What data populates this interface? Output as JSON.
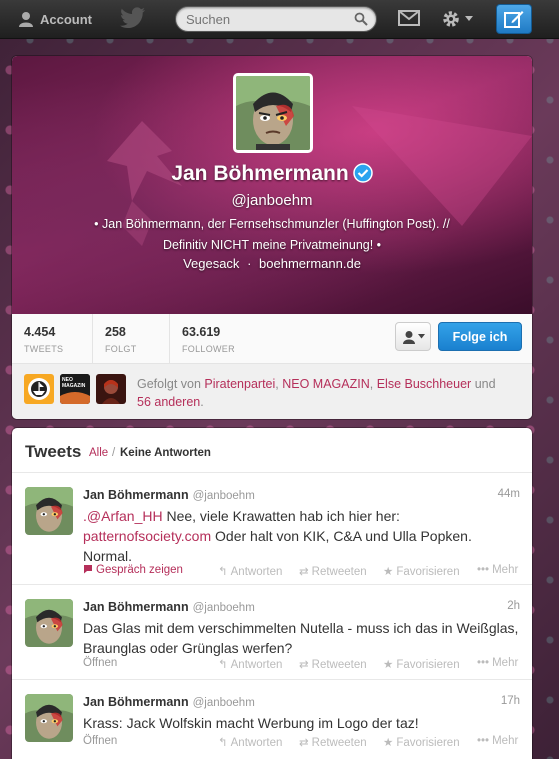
{
  "topbar": {
    "account_label": "Account",
    "search_placeholder": "Suchen"
  },
  "profile": {
    "name": "Jan Böhmermann",
    "handle": "@janboehm",
    "bio_line1": "• Jan Böhmermann, der Fernsehschmunzler (Huffington Post). //",
    "bio_line2": "Definitiv NICHT meine Privatmeinung! •",
    "location": "Vegesack",
    "loc_sep": "·",
    "website": "boehmermann.de",
    "colors": {
      "accent": "#b52f5a",
      "follow_button": "#1a80cf",
      "verified": "#2aa3ef"
    }
  },
  "stats": [
    {
      "num": "4.454",
      "label": "TWEETS"
    },
    {
      "num": "258",
      "label": "FOLGT"
    },
    {
      "num": "63.619",
      "label": "FOLLOWER"
    }
  ],
  "actions": {
    "follow_label": "Folge ich"
  },
  "followed": {
    "prefix": "Gefolgt von ",
    "user1": "Piratenpartei",
    "comma1": ", ",
    "user2": "NEO MAGAZIN",
    "comma2": ", ",
    "user3": "Else Buschheuer",
    "and": " und",
    "others": "56 anderen",
    "dot": ".",
    "neo_label": "NEO MAGAZIN"
  },
  "tweets_header": {
    "title": "Tweets",
    "filter_all": "Alle",
    "sep": "/",
    "filter_no_replies": "Keine Antworten"
  },
  "tweet_actions": {
    "reply": "Antworten",
    "retweet": "Retweeten",
    "favorite": "Favorisieren",
    "more": "Mehr"
  },
  "tweets": [
    {
      "name": "Jan Böhmermann",
      "handle": "@janboehm",
      "time": "44m",
      "mention": ".@Arfan_HH",
      "text_a": " Nee, viele Krawatten hab ich hier her:",
      "link": "patternofsociety.com",
      "text_b": " Oder halt von KIK, C&A und Ulla Popken. Normal.",
      "left_action": "Gespräch zeigen"
    },
    {
      "name": "Jan Böhmermann",
      "handle": "@janboehm",
      "time": "2h",
      "text": "Das Glas mit dem verschimmelten Nutella - muss ich das in Weißglas, Braunglas oder Grünglas werfen?",
      "left_action": "Öffnen"
    },
    {
      "name": "Jan Böhmermann",
      "handle": "@janboehm",
      "time": "17h",
      "text": "Krass: Jack Wolfskin macht Werbung im Logo der taz!",
      "left_action": "Öffnen"
    }
  ]
}
